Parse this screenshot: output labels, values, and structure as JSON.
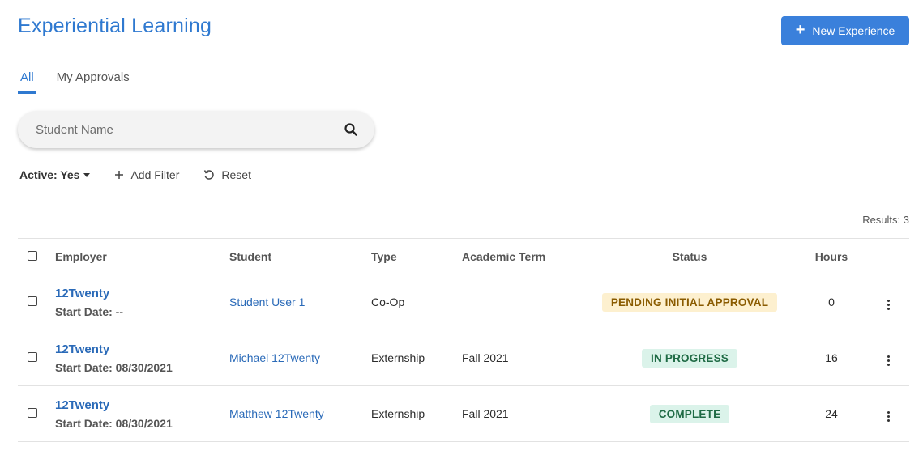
{
  "header": {
    "title": "Experiential Learning",
    "new_button_label": "New Experience",
    "accent_color": "#3a80db"
  },
  "tabs": [
    {
      "label": "All",
      "active": true
    },
    {
      "label": "My Approvals",
      "active": false
    }
  ],
  "search": {
    "placeholder": "Student Name",
    "value": "",
    "icon": "search-icon"
  },
  "filters": {
    "active_label": "Active: Yes",
    "add_filter_label": "Add Filter",
    "reset_label": "Reset"
  },
  "results_label": "Results: 3",
  "table": {
    "columns": [
      "Employer",
      "Student",
      "Type",
      "Academic Term",
      "Status",
      "Hours"
    ],
    "rows": [
      {
        "employer": "12Twenty",
        "start_date": "Start Date: --",
        "student": "Student User 1",
        "type": "Co-Op",
        "term": "",
        "status": "PENDING INITIAL APPROVAL",
        "status_bg": "#fdf0cf",
        "status_fg": "#8a5b00",
        "hours": "0"
      },
      {
        "employer": "12Twenty",
        "start_date": "Start Date: 08/30/2021",
        "student": "Michael 12Twenty",
        "type": "Externship",
        "term": "Fall 2021",
        "status": "IN PROGRESS",
        "status_bg": "#dbf3ea",
        "status_fg": "#1f6b45",
        "hours": "16"
      },
      {
        "employer": "12Twenty",
        "start_date": "Start Date: 08/30/2021",
        "student": "Matthew 12Twenty",
        "type": "Externship",
        "term": "Fall 2021",
        "status": "COMPLETE",
        "status_bg": "#dbf3ea",
        "status_fg": "#1f6b45",
        "hours": "24"
      }
    ]
  }
}
